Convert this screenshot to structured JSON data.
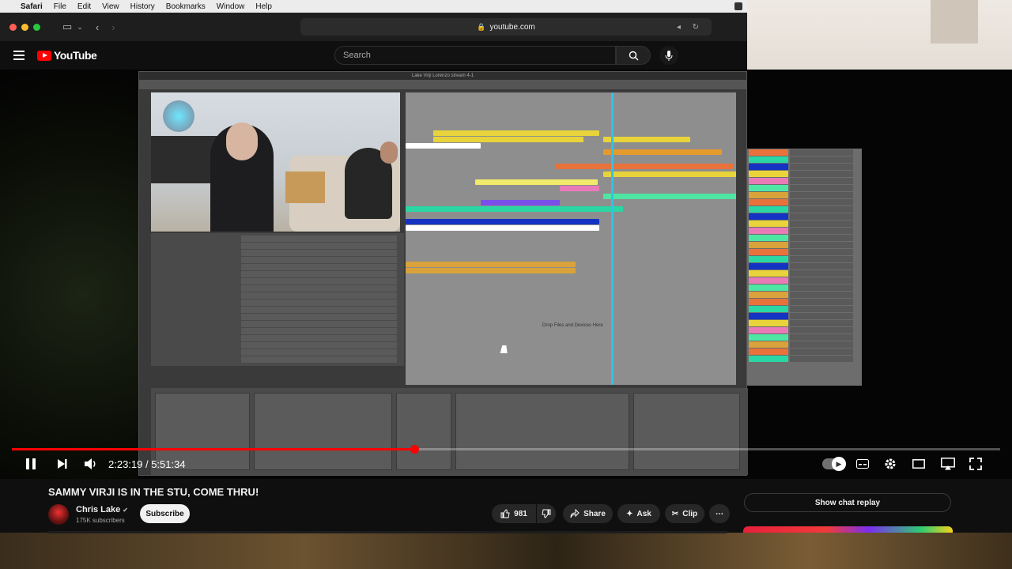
{
  "menubar": {
    "app": "Safari",
    "items": [
      "File",
      "Edit",
      "View",
      "History",
      "Bookmarks",
      "Window",
      "Help"
    ]
  },
  "browser": {
    "url": "youtube.com"
  },
  "youtube": {
    "logo_text": "YouTube",
    "search_placeholder": "Search"
  },
  "daw": {
    "window_title": "Lake Virji Lorenzo stream 4-1",
    "drop_hint": "Drop Files and Devices Here"
  },
  "player": {
    "current_time": "2:23:19",
    "duration": "5:51:34",
    "time_display": "2:23:19 / 5:51:34",
    "progress_fraction": 0.4075,
    "state": "playing"
  },
  "video": {
    "title": "SAMMY VIRJI IS IN THE STU, COME THRU!",
    "channel": "Chris Lake",
    "subscribers": "175K subscribers",
    "subscribe_label": "Subscribe",
    "likes": "981",
    "share_label": "Share",
    "ask_label": "Ask",
    "clip_label": "Clip",
    "chat_replay_label": "Show chat replay"
  },
  "colors": {
    "accent": "#ff0000",
    "background": "#0f0f0f",
    "pill": "#272727"
  }
}
